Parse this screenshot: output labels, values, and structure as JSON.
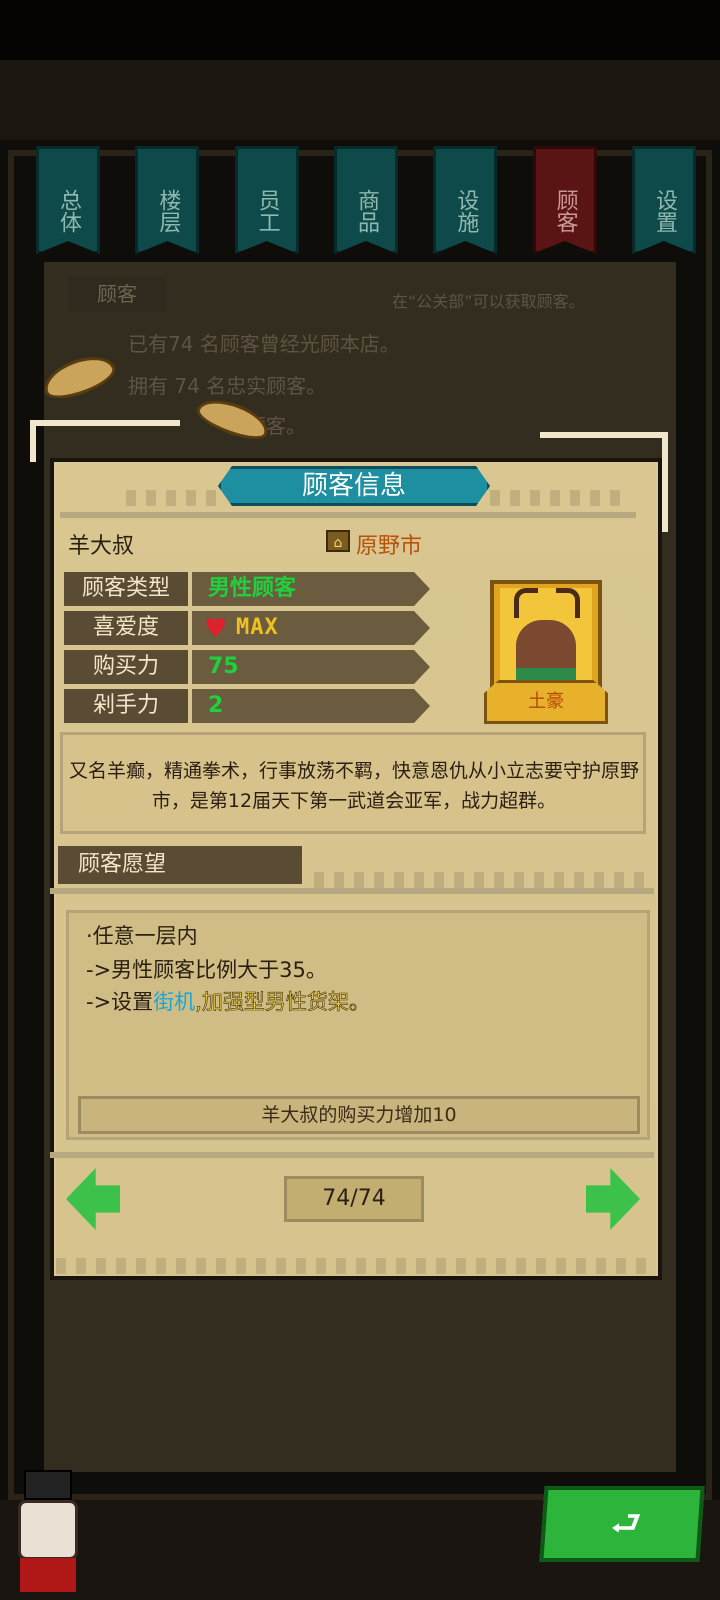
{
  "tabs": [
    {
      "label": "总体",
      "active": false
    },
    {
      "label": "楼层",
      "active": false
    },
    {
      "label": "员工",
      "active": false
    },
    {
      "label": "商品",
      "active": false
    },
    {
      "label": "设施",
      "active": false
    },
    {
      "label": "顾客",
      "active": true
    },
    {
      "label": "设置",
      "active": false
    }
  ],
  "background": {
    "section_label": "顾客",
    "hint": "在“公关部”可以获取顾客。",
    "line1": "已有74 名顾客曾经光顾本店。",
    "line2": "拥有 74 名忠实顾客。",
    "line3": "名顾客。"
  },
  "dialog": {
    "title": "顾客信息",
    "customer_name": "羊大叔",
    "city_icon": "city-icon",
    "city_name": "原野市",
    "stats": [
      {
        "label": "顾客类型",
        "value": "男性顾客",
        "color": "#1fd13a"
      },
      {
        "label": "喜爱度",
        "value": "MAX",
        "color": "#f0c020",
        "icon": "heart-icon"
      },
      {
        "label": "购买力",
        "value": "75",
        "color": "#1fd13a"
      },
      {
        "label": "剁手力",
        "value": "2",
        "color": "#1fd13a"
      }
    ],
    "portrait_badge": "土豪",
    "description": "又名羊癫，精通拳术，行事放荡不羁，快意恩仇从小立志要守护原野市，是第12届天下第一武道会亚军，战力超群。",
    "wish_label": "顾客愿望",
    "wish": {
      "line1": "·任意一层内",
      "line2": "->男性顾客比例大于35。",
      "line3_prefix": "->设置",
      "line3_blue": "街机",
      "line3_yellow": ",加强型男性货架。"
    },
    "reward": "羊大叔的购买力增加10",
    "page": "74/74"
  },
  "colors": {
    "accent_teal": "#1d8fa0",
    "arrow_green": "#3cc24a",
    "city_orange": "#b5530a"
  }
}
